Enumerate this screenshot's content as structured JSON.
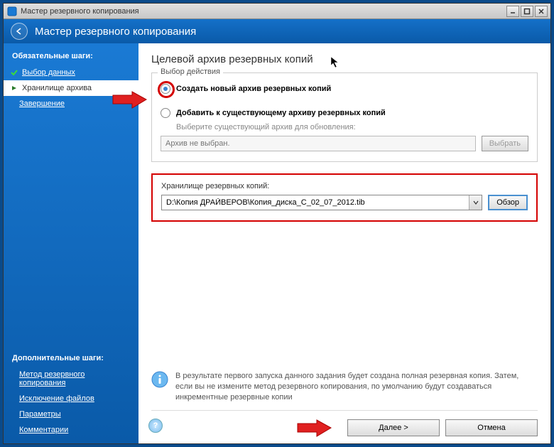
{
  "titlebar": {
    "title": "Мастер резервного копирования"
  },
  "header": {
    "label": "Мастер резервного копирования"
  },
  "sidebar": {
    "mandatory_title": "Обязательные шаги:",
    "additional_title": "Дополнительные шаги:",
    "steps": [
      {
        "label": "Выбор данных"
      },
      {
        "label": "Хранилище архива"
      },
      {
        "label": "Завершение"
      }
    ],
    "extras": [
      {
        "label": "Метод резервного копирования"
      },
      {
        "label": "Исключение файлов"
      },
      {
        "label": "Параметры"
      },
      {
        "label": "Комментарии"
      }
    ]
  },
  "main": {
    "heading": "Целевой архив резервных копий",
    "fieldset_legend": "Выбор действия",
    "opt_create": "Создать новый архив резервных копий",
    "opt_append": "Добавить к существующему архиву резервных копий",
    "append_hint": "Выберите существующий архив для обновления:",
    "append_placeholder": "Архив не выбран.",
    "append_browse": "Выбрать",
    "storage_label": "Хранилище резервных копий:",
    "storage_path": "D:\\Копия ДРАЙВЕРОВ\\Копия_диска_С_02_07_2012.tib",
    "storage_browse": "Обзор",
    "info_text": "В результате первого запуска данного задания будет создана полная резервная копия. Затем, если вы не измените метод резервного копирования, по умолчанию будут создаваться инкрементные резервные копии",
    "btn_next": "Далее >",
    "btn_cancel": "Отмена"
  }
}
